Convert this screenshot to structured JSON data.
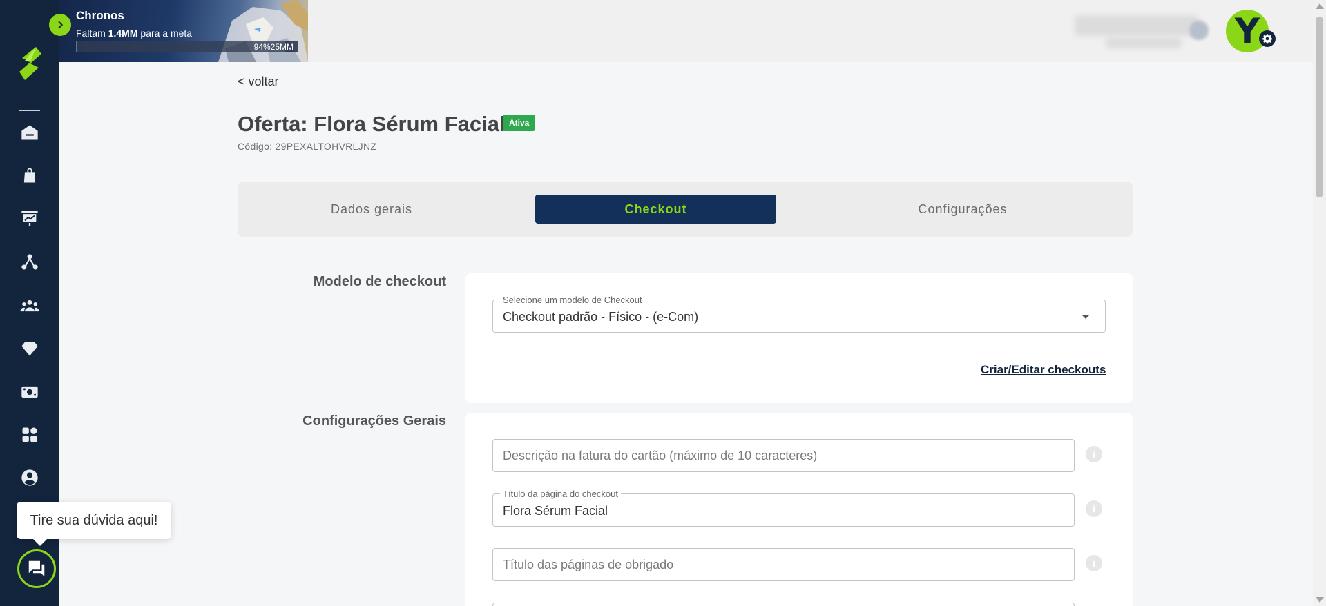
{
  "banner": {
    "title": "Chronos",
    "subtitle_prefix": "Faltam ",
    "subtitle_amount": "1.4MM",
    "subtitle_suffix": " para a meta",
    "progress_value": 0.94,
    "progress_text": "94%25MM"
  },
  "header": {
    "avatar_letter": "Y"
  },
  "sidebar": {
    "items": [
      {
        "name": "home-icon"
      },
      {
        "name": "shopping-bag-icon"
      },
      {
        "name": "dashboard-icon"
      },
      {
        "name": "network-icon"
      },
      {
        "name": "users-icon"
      },
      {
        "name": "diamond-icon"
      },
      {
        "name": "money-icon"
      },
      {
        "name": "apps-icon"
      },
      {
        "name": "account-icon"
      }
    ]
  },
  "page": {
    "back_label": "< voltar",
    "title": "Oferta: Flora Sérum Facial",
    "status": "Ativa",
    "code": "Código: 29PEXALTOHVRLJNZ"
  },
  "tabs": [
    {
      "label": "Dados gerais",
      "active": false
    },
    {
      "label": "Checkout",
      "active": true
    },
    {
      "label": "Configurações",
      "active": false
    }
  ],
  "checkout_model": {
    "section_label": "Modelo de checkout",
    "select_legend": "Selecione um modelo de Checkout",
    "select_value": "Checkout padrão - Físico - (e-Com)",
    "link_label": "Criar/Editar checkouts"
  },
  "general_settings": {
    "section_label": "Configurações Gerais",
    "card_description_placeholder": "Descrição na fatura do cartão (máximo de 10 caracteres)",
    "page_title_legend": "Título da página do checkout",
    "page_title_value": "Flora Sérum Facial",
    "thanks_title_placeholder": "Título das páginas de obrigado"
  },
  "help": {
    "tooltip": "Tire sua dúvida aqui!"
  },
  "colors": {
    "sidebar": "#13243d",
    "accent": "#8bd617",
    "active_tab": "#13305a",
    "badge": "#2fa84f"
  }
}
